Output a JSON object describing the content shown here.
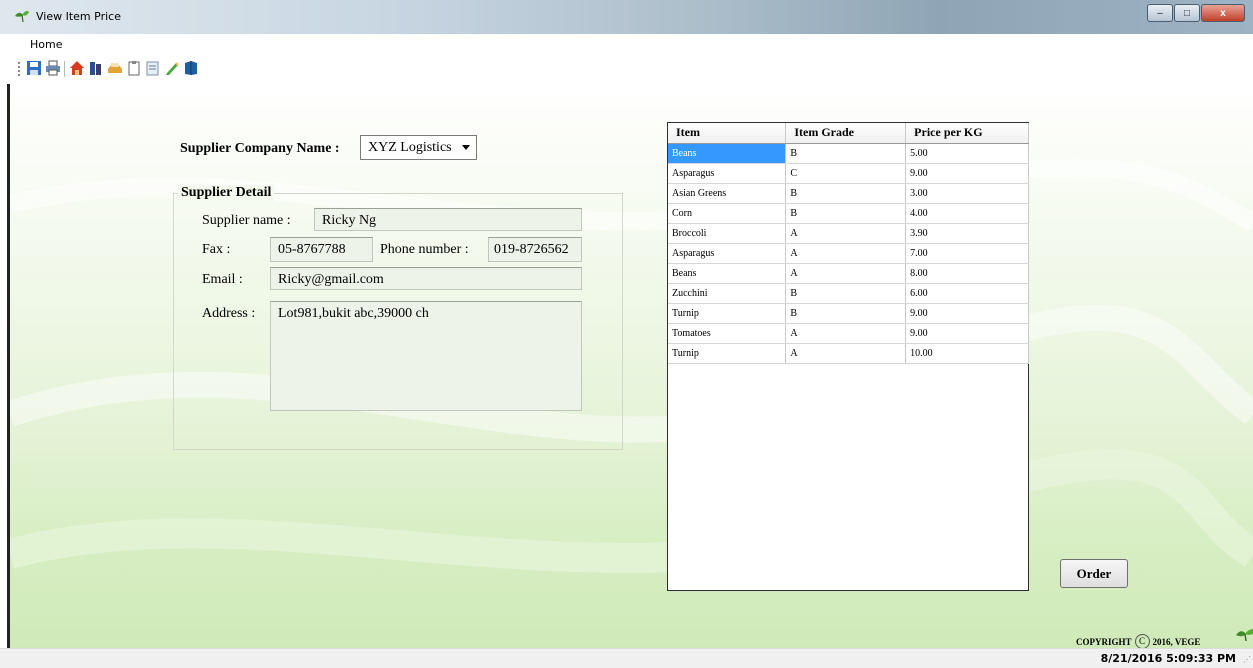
{
  "window": {
    "title": "View Item Price",
    "minimize_glyph": "–",
    "maximize_glyph": "□",
    "close_glyph": "x"
  },
  "menu": {
    "items": [
      "Home"
    ]
  },
  "toolbar": {
    "icons": [
      "save-icon",
      "print-icon",
      "home-icon",
      "books-icon",
      "tray-icon",
      "clipboard-icon",
      "report-icon",
      "pencil-icon",
      "book-icon"
    ]
  },
  "form": {
    "supplier_company_label": "Supplier Company Name :",
    "supplier_company_value": "XYZ Logistics",
    "supplier_detail_title": "Supplier Detail",
    "supplier_name_label": "Supplier name :",
    "supplier_name_value": "Ricky Ng",
    "fax_label": "Fax :",
    "fax_value": "05-8767788",
    "phone_label": "Phone number :",
    "phone_value": "019-8726562",
    "email_label": "Email :",
    "email_value": "Ricky@gmail.com",
    "address_label": "Address :",
    "address_value": "Lot981,bukit abc,39000 ch"
  },
  "grid": {
    "columns": [
      "Item",
      "Item Grade",
      "Price per KG"
    ],
    "rows": [
      [
        "Beans",
        "B",
        "5.00"
      ],
      [
        "Asparagus",
        "C",
        "9.00"
      ],
      [
        "Asian Greens",
        "B",
        "3.00"
      ],
      [
        "Corn",
        "B",
        "4.00"
      ],
      [
        "Broccoli",
        "A",
        "3.90"
      ],
      [
        "Asparagus",
        "A",
        "7.00"
      ],
      [
        "Beans",
        "A",
        "8.00"
      ],
      [
        "Zucchini",
        "B",
        "6.00"
      ],
      [
        "Turnip",
        "B",
        "9.00"
      ],
      [
        "Tomatoes",
        "A",
        "9.00"
      ],
      [
        "Turnip",
        "A",
        "10.00"
      ]
    ],
    "selected_row": 0
  },
  "order_button": "Order",
  "copyright": {
    "prefix": "COPYRIGHT",
    "symbol": "C",
    "suffix": "2016, VEGE"
  },
  "status": {
    "datetime": "8/21/2016 5:09:33 PM"
  },
  "colors": {
    "selection": "#3399ff",
    "accent_green": "#4a9a2a"
  }
}
